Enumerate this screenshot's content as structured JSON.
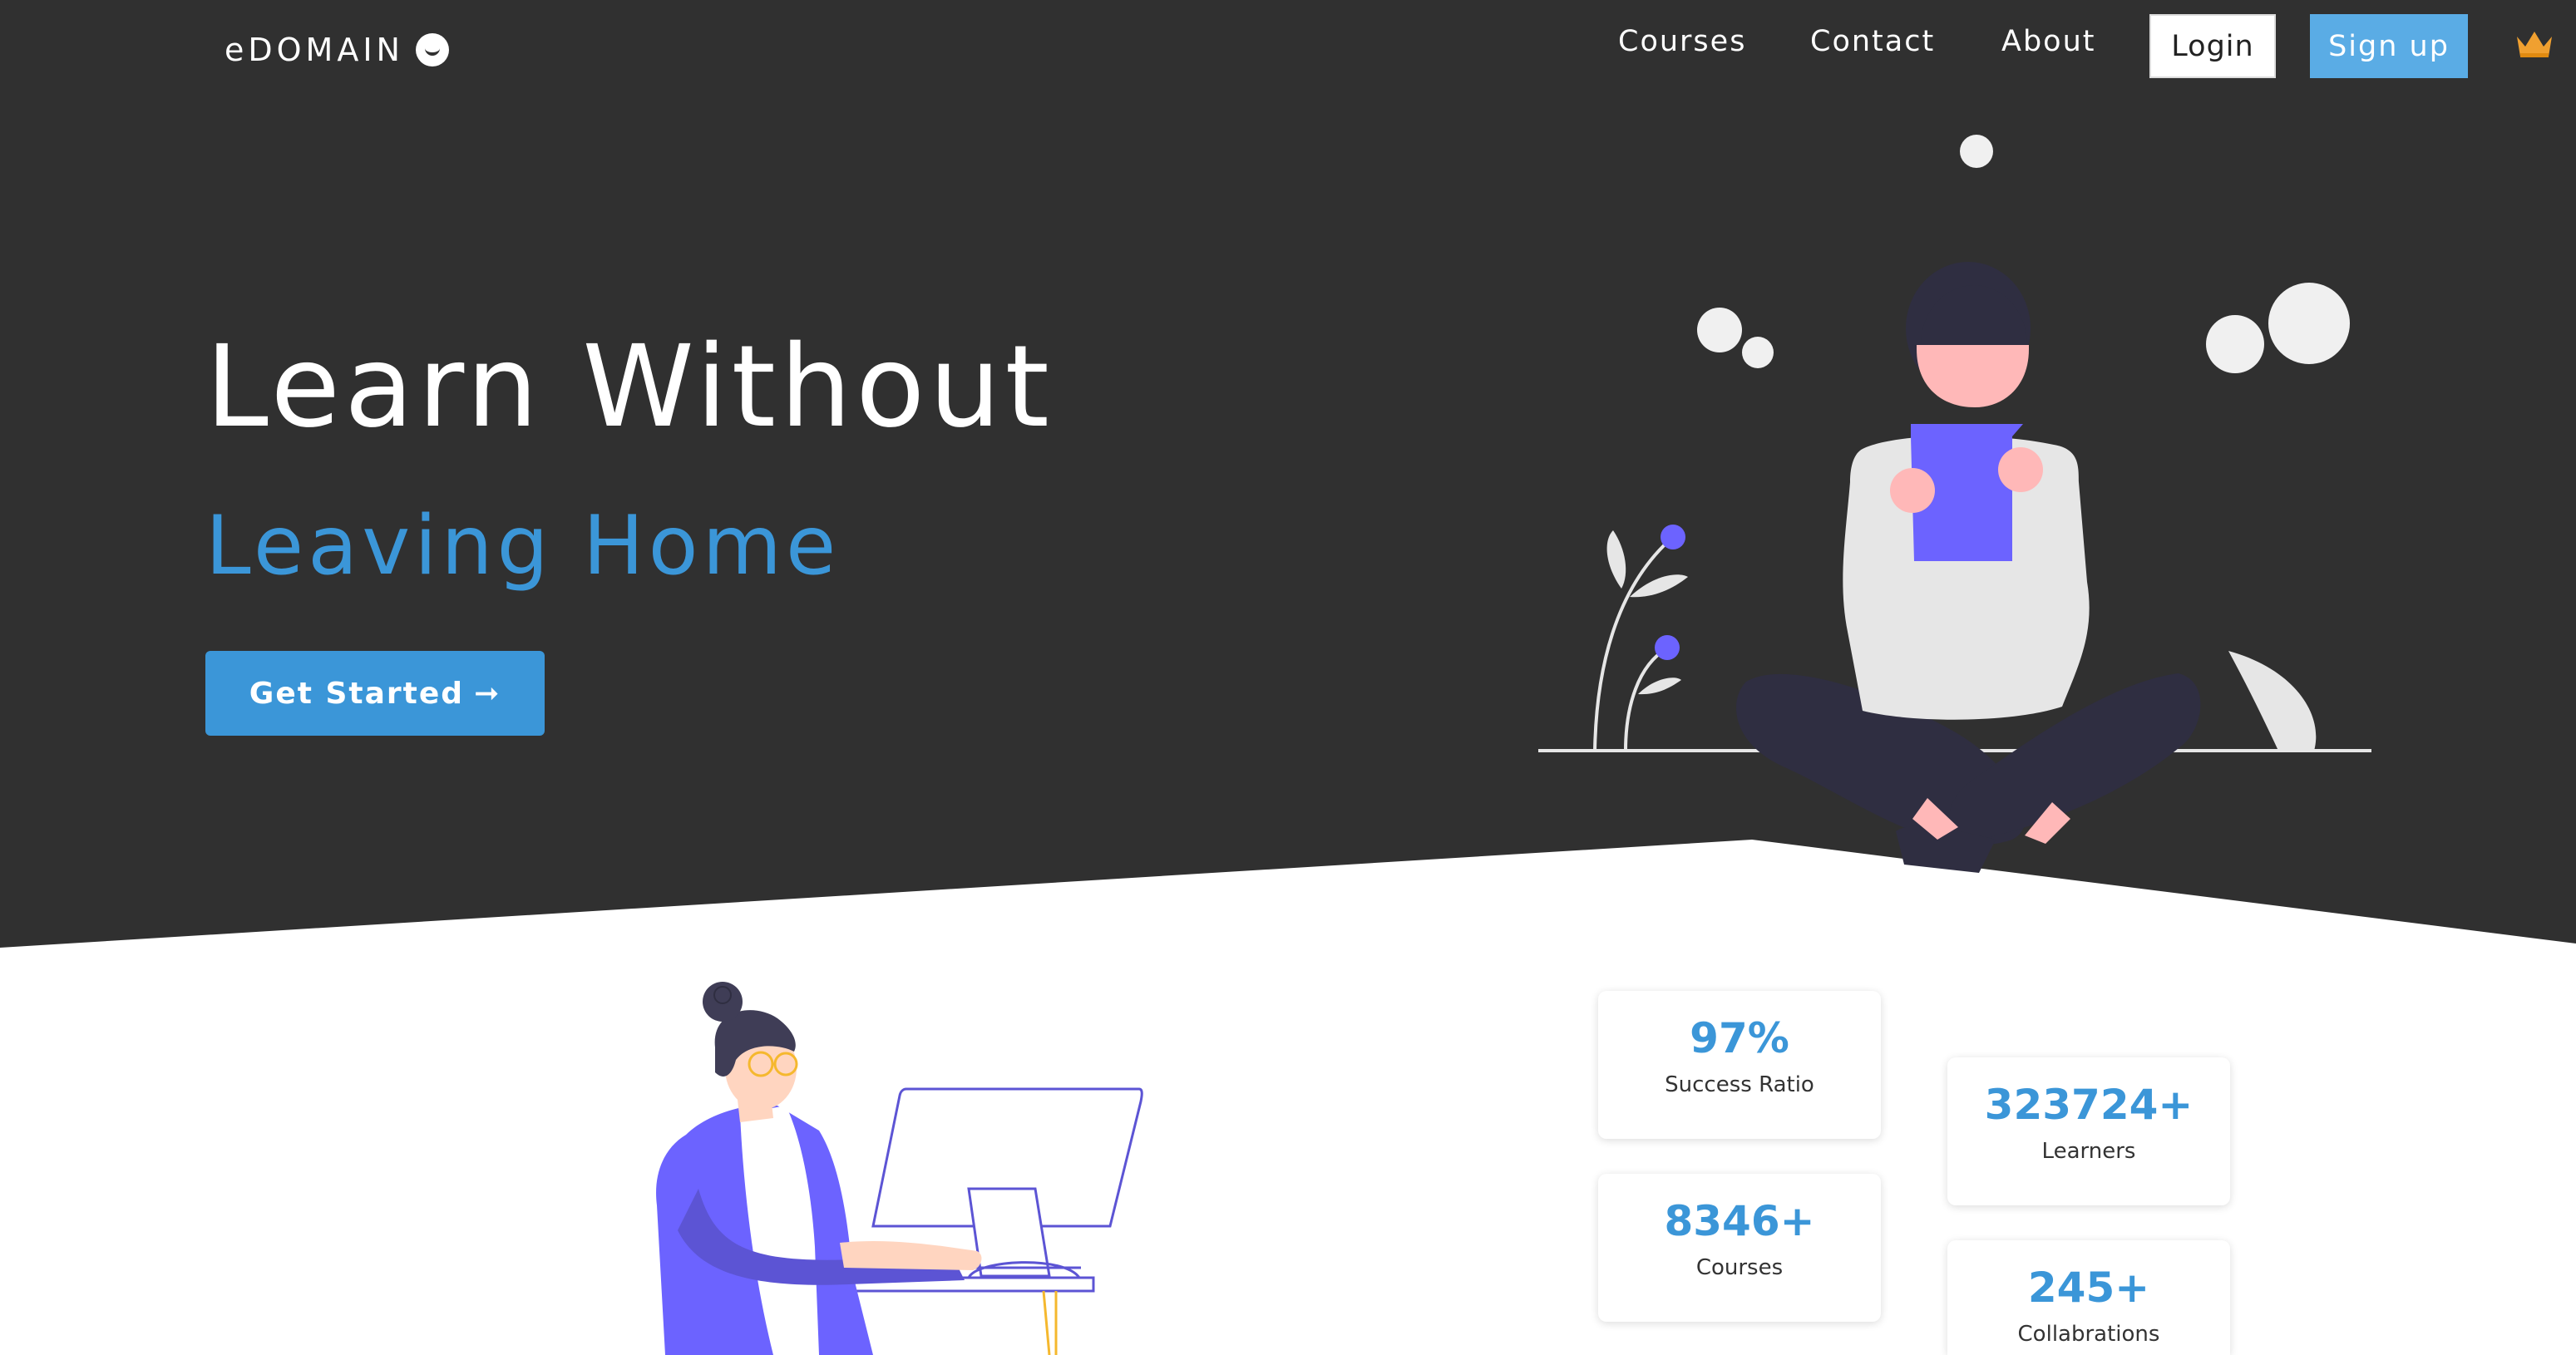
{
  "brand": {
    "name": "eDOMAIN"
  },
  "nav": {
    "courses": "Courses",
    "contact": "Contact",
    "about": "About",
    "login": "Login",
    "signup": "Sign up"
  },
  "hero": {
    "line1": "Learn Without",
    "line2": "Leaving Home",
    "cta": "Get Started",
    "cta_arrow": "➞"
  },
  "stats": [
    {
      "value": "97%",
      "label": "Success Ratio"
    },
    {
      "value": "323724+",
      "label": "Learners"
    },
    {
      "value": "8346+",
      "label": "Courses"
    },
    {
      "value": "245+",
      "label": "Collabrations"
    }
  ],
  "colors": {
    "hero_bg": "#303030",
    "accent": "#3b96d8",
    "signup": "#5aace5",
    "illustration_purple": "#6c63ff",
    "crown": "#f0a030"
  },
  "icons": {
    "logo": "smiley-icon",
    "premium": "crown-icon",
    "cta": "arrow-right-icon"
  }
}
